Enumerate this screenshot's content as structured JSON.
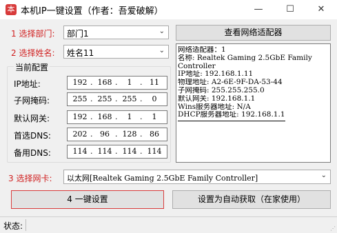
{
  "window": {
    "title": "本机IP一键设置（作者：吾爱破解）",
    "icon_name": "app-icon",
    "minimize_glyph": "—",
    "maximize_glyph": "☐",
    "close_glyph": "✕"
  },
  "step1": {
    "label": "1 选择部门:",
    "value": "部门1"
  },
  "step2": {
    "label": "2 选择姓名:",
    "value": "姓名11"
  },
  "view_adapter_button": "查看网络适配器",
  "config_group": {
    "title": "当前配置",
    "fields": [
      {
        "label": "IP地址:",
        "octets": [
          "192",
          "168",
          "1",
          "11"
        ]
      },
      {
        "label": "子网掩码:",
        "octets": [
          "255",
          "255",
          "255",
          "0"
        ]
      },
      {
        "label": "默认网关:",
        "octets": [
          "192",
          "168",
          "1",
          "1"
        ]
      },
      {
        "label": "首选DNS:",
        "octets": [
          "202",
          "96",
          "128",
          "86"
        ]
      },
      {
        "label": "备用DNS:",
        "octets": [
          "114",
          "114",
          "114",
          "114"
        ]
      }
    ]
  },
  "adapter_info": {
    "lines": [
      "网络适配器：1",
      "名称: Realtek Gaming 2.5GbE Family Controller",
      "IP地址: 192.168.1.11",
      "物理地址: A2-6E-9F-DA-53-44",
      "子网掩码: 255.255.255.0",
      "默认网关: 192.168.1.1",
      "Wins服务器地址: N/A",
      "DHCP服务器地址: 192.168.1.1"
    ]
  },
  "step3": {
    "label": "3 选择网卡:",
    "value": "以太网[Realtek Gaming 2.5GbE Family Controller]"
  },
  "apply_button": "4 一键设置",
  "auto_button": "设置为自动获取（在家使用）",
  "status": {
    "label": "状态:",
    "text": ""
  },
  "colors": {
    "accent_red": "#d01e1e",
    "background": "#f0f0f0"
  }
}
